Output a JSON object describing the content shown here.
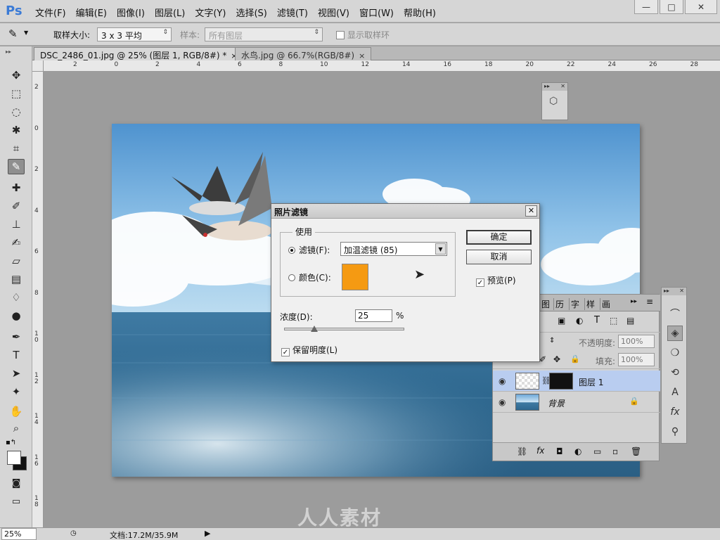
{
  "app": {
    "logo": "Ps"
  },
  "menu": [
    "文件(F)",
    "编辑(E)",
    "图像(I)",
    "图层(L)",
    "文字(Y)",
    "选择(S)",
    "滤镜(T)",
    "视图(V)",
    "窗口(W)",
    "帮助(H)"
  ],
  "window_buttons": {
    "minimize": "—",
    "maximize": "□",
    "close": "✕"
  },
  "options": {
    "sample_size_label": "取样大小:",
    "sample_size_value": "3 x 3 平均",
    "sample_label": "样本:",
    "sample_value": "所有图层",
    "show_ring_label": "显示取样环"
  },
  "tabs": [
    {
      "label": "DSC_2486_01.jpg @ 25% (图层 1, RGB/8#) *",
      "close": "×"
    },
    {
      "label": "水鸟.jpg @ 66.7%(RGB/8#)",
      "close": "×"
    }
  ],
  "ruler_h": [
    "2",
    "0",
    "2",
    "4",
    "6",
    "8",
    "10",
    "12",
    "14",
    "16",
    "18",
    "20",
    "22",
    "24",
    "26",
    "28"
  ],
  "ruler_v": [
    "2",
    "0",
    "2",
    "4",
    "6",
    "8",
    "1\n0",
    "1\n2",
    "1\n4",
    "1\n6",
    "1\n8"
  ],
  "status": {
    "zoom": "25%",
    "doc_label": "文档:17.2M/35.9M",
    "arrow": "▶"
  },
  "dialog": {
    "title": "照片滤镜",
    "close": "✕",
    "use_legend": "使用",
    "filter_label": "滤镜(F):",
    "filter_value": "加温滤镜 (85)",
    "color_label": "颜色(C):",
    "swatch_color": "#f59a12",
    "ok": "确定",
    "cancel": "取消",
    "preview_label": "预览(P)",
    "density_label": "浓度(D):",
    "density_value": "25",
    "density_unit": "%",
    "density_level": 0.25,
    "preserve_label": "保留明度(L)"
  },
  "layers_panel": {
    "tabs": [
      "图",
      "历",
      "字",
      "样",
      "画"
    ],
    "opacity_label": "不透明度:",
    "opacity_value": "100%",
    "fill_label": "填充:",
    "fill_value": "100%",
    "layers": [
      {
        "name": "图层 1",
        "selected": true
      },
      {
        "name": "背景",
        "selected": false
      }
    ]
  },
  "watermark": "人人素材"
}
